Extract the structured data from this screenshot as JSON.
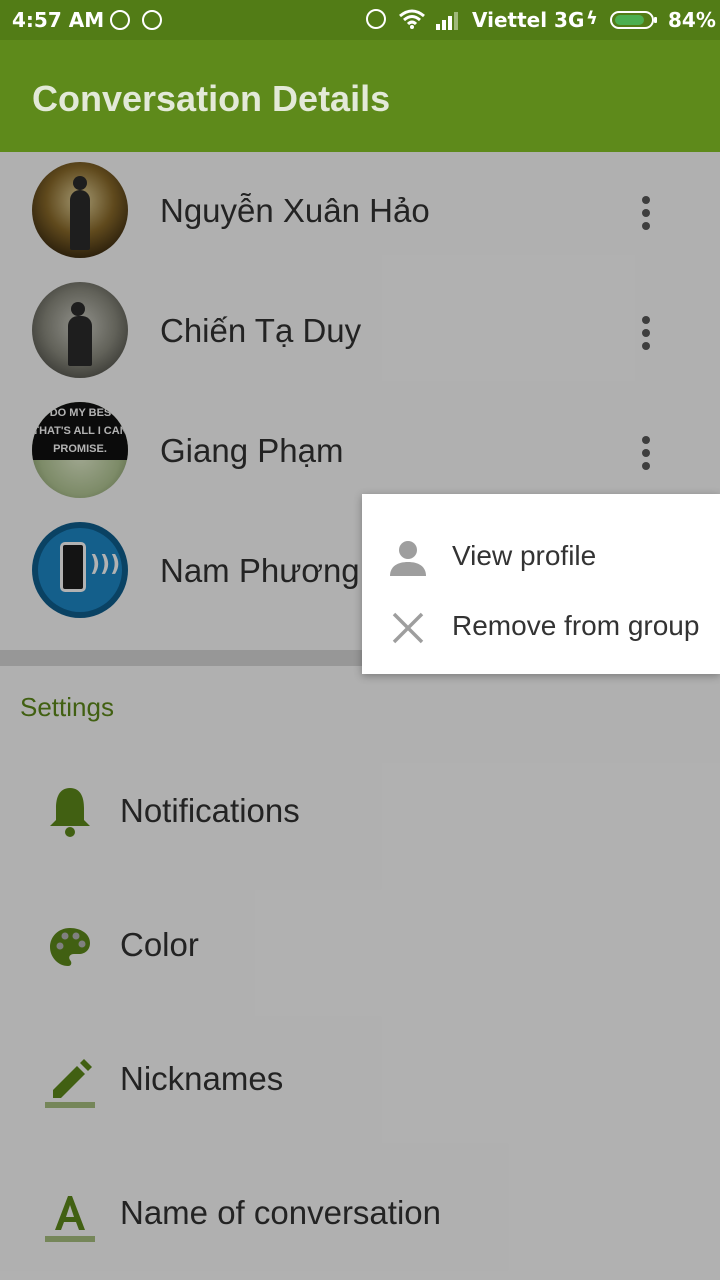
{
  "status_bar": {
    "time": "4:57 AM",
    "carrier": "Viettel 3G",
    "battery": "84%",
    "battery_level": 84,
    "icons": [
      "app-notification-icon",
      "app-notification-icon",
      "alarm-icon",
      "wifi-icon",
      "signal-icon",
      "charging-icon",
      "battery-icon"
    ]
  },
  "app_bar": {
    "title": "Conversation Details"
  },
  "members": [
    {
      "name": "Nguyễn Xuân Hảo"
    },
    {
      "name": "Chiến Tạ Duy"
    },
    {
      "name": "Giang Phạm",
      "avatar_text": "L DO MY BEST, THAT'S ALL I CAN PROMISE."
    },
    {
      "name": "Nam Phương"
    }
  ],
  "settings": {
    "section_title": "Settings",
    "items": [
      {
        "label": "Notifications",
        "icon": "bell-icon"
      },
      {
        "label": "Color",
        "icon": "palette-icon"
      },
      {
        "label": "Nicknames",
        "icon": "pencil-icon"
      },
      {
        "label": "Name of conversation",
        "icon": "text-a-icon"
      }
    ]
  },
  "popup_menu": {
    "items": [
      {
        "label": "View profile",
        "icon": "person-icon"
      },
      {
        "label": "Remove from group",
        "icon": "close-icon"
      }
    ]
  },
  "colors": {
    "status_bar": "#527c16",
    "app_bar": "#5e8a1b",
    "accent": "#5e8a1b",
    "battery_fill": "#4caf50"
  }
}
